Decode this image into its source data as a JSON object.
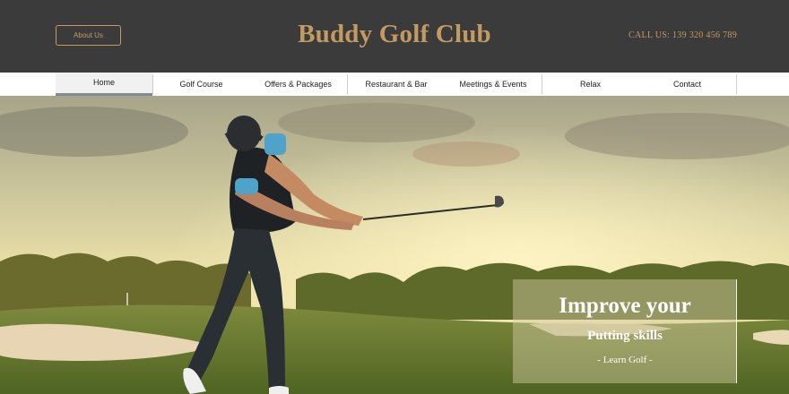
{
  "header": {
    "about_label": "About Us",
    "title": "Buddy Golf Club",
    "call_label": "CALL US: 139 320 456 789"
  },
  "nav": {
    "items": [
      {
        "label": "Home",
        "active": true
      },
      {
        "label": "Golf Course"
      },
      {
        "label": "Offers & Packages"
      },
      {
        "label": "Restaurant & Bar"
      },
      {
        "label": "Meetings & Events"
      },
      {
        "label": "Relax"
      },
      {
        "label": "Contact"
      }
    ]
  },
  "promo": {
    "title": "Improve your",
    "subtitle": "Putting skills",
    "link": "- Learn Golf -"
  },
  "colors": {
    "header_bg": "#3b3b3b",
    "accent_gold": "#c29a62",
    "nav_bg": "#ffffff"
  },
  "hero": {
    "image": "golfer-swing-photo"
  }
}
